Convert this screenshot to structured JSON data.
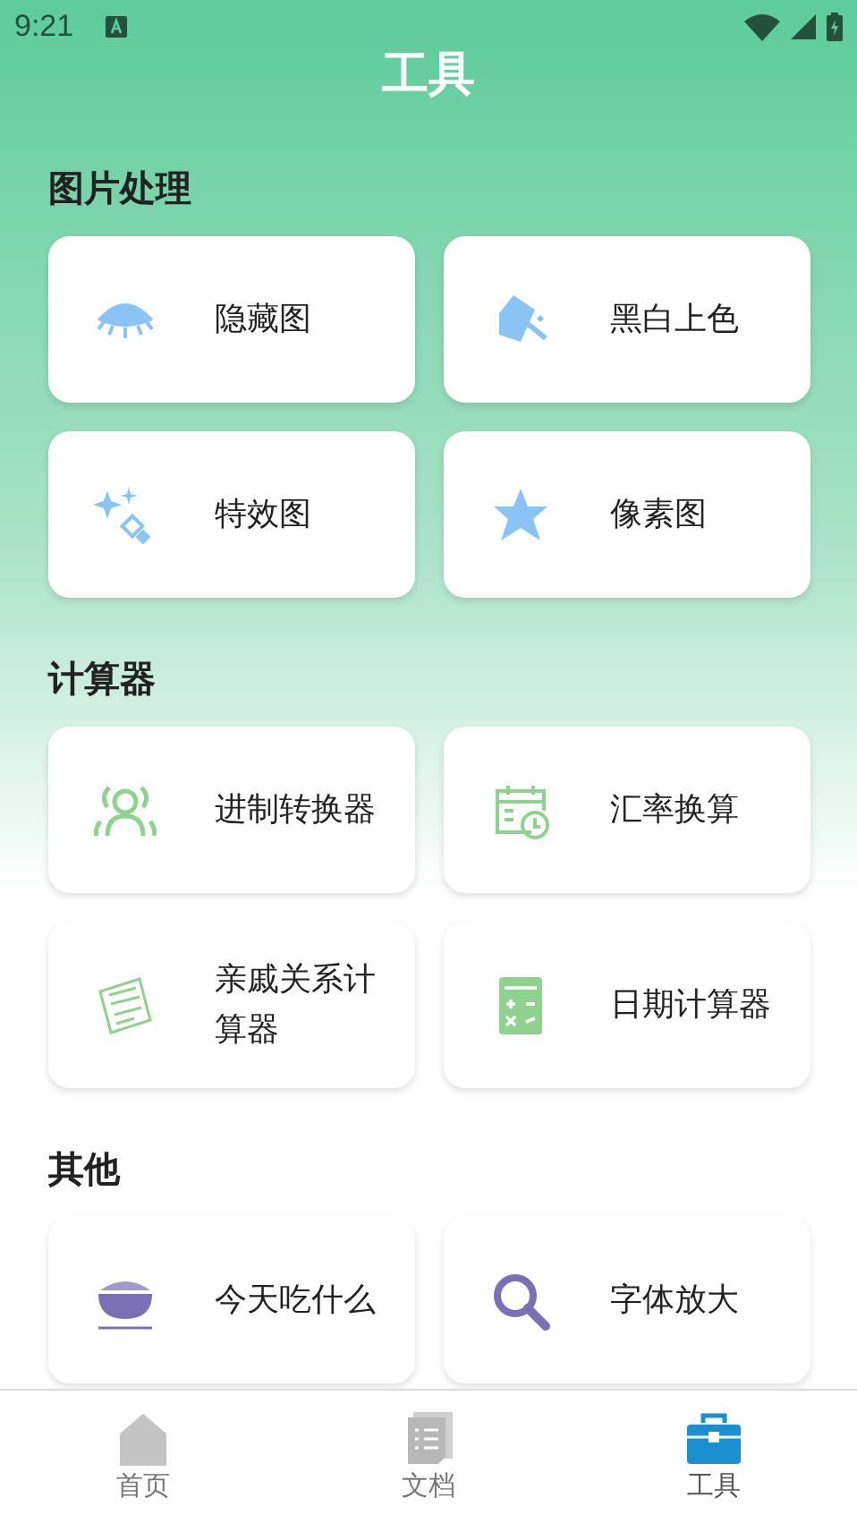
{
  "status_bar": {
    "time": "9:21"
  },
  "title": "工具",
  "sections": [
    {
      "title": "图片处理",
      "color": "#8ac4f5",
      "items": [
        {
          "label": "隐藏图"
        },
        {
          "label": "黑白上色"
        },
        {
          "label": "特效图"
        },
        {
          "label": "像素图"
        }
      ]
    },
    {
      "title": "计算器",
      "color": "#8fd18f",
      "items": [
        {
          "label": "进制转换器"
        },
        {
          "label": "汇率换算"
        },
        {
          "label": "亲戚关系计算器"
        },
        {
          "label": "日期计算器"
        }
      ]
    },
    {
      "title": "其他",
      "color": "#7b6fb5",
      "items": [
        {
          "label": "今天吃什么"
        },
        {
          "label": "字体放大"
        }
      ]
    }
  ],
  "tabs": [
    {
      "label": "首页",
      "selected": false
    },
    {
      "label": "文档",
      "selected": false
    },
    {
      "label": "工具",
      "selected": true
    }
  ]
}
